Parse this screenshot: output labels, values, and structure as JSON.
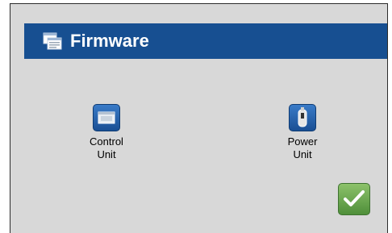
{
  "header": {
    "title": "Firmware",
    "icon": "window-stack-icon"
  },
  "units": [
    {
      "label_line1": "Control",
      "label_line2": "Unit",
      "icon": "control-unit-icon"
    },
    {
      "label_line1": "Power",
      "label_line2": "Unit",
      "icon": "power-unit-icon"
    }
  ],
  "actions": {
    "confirm_icon": "checkmark-icon"
  },
  "colors": {
    "titlebar": "#174f91",
    "panel_bg": "#d8d8d8",
    "icon_blue": "#1a4f94",
    "confirm_green": "#5e9e45"
  }
}
